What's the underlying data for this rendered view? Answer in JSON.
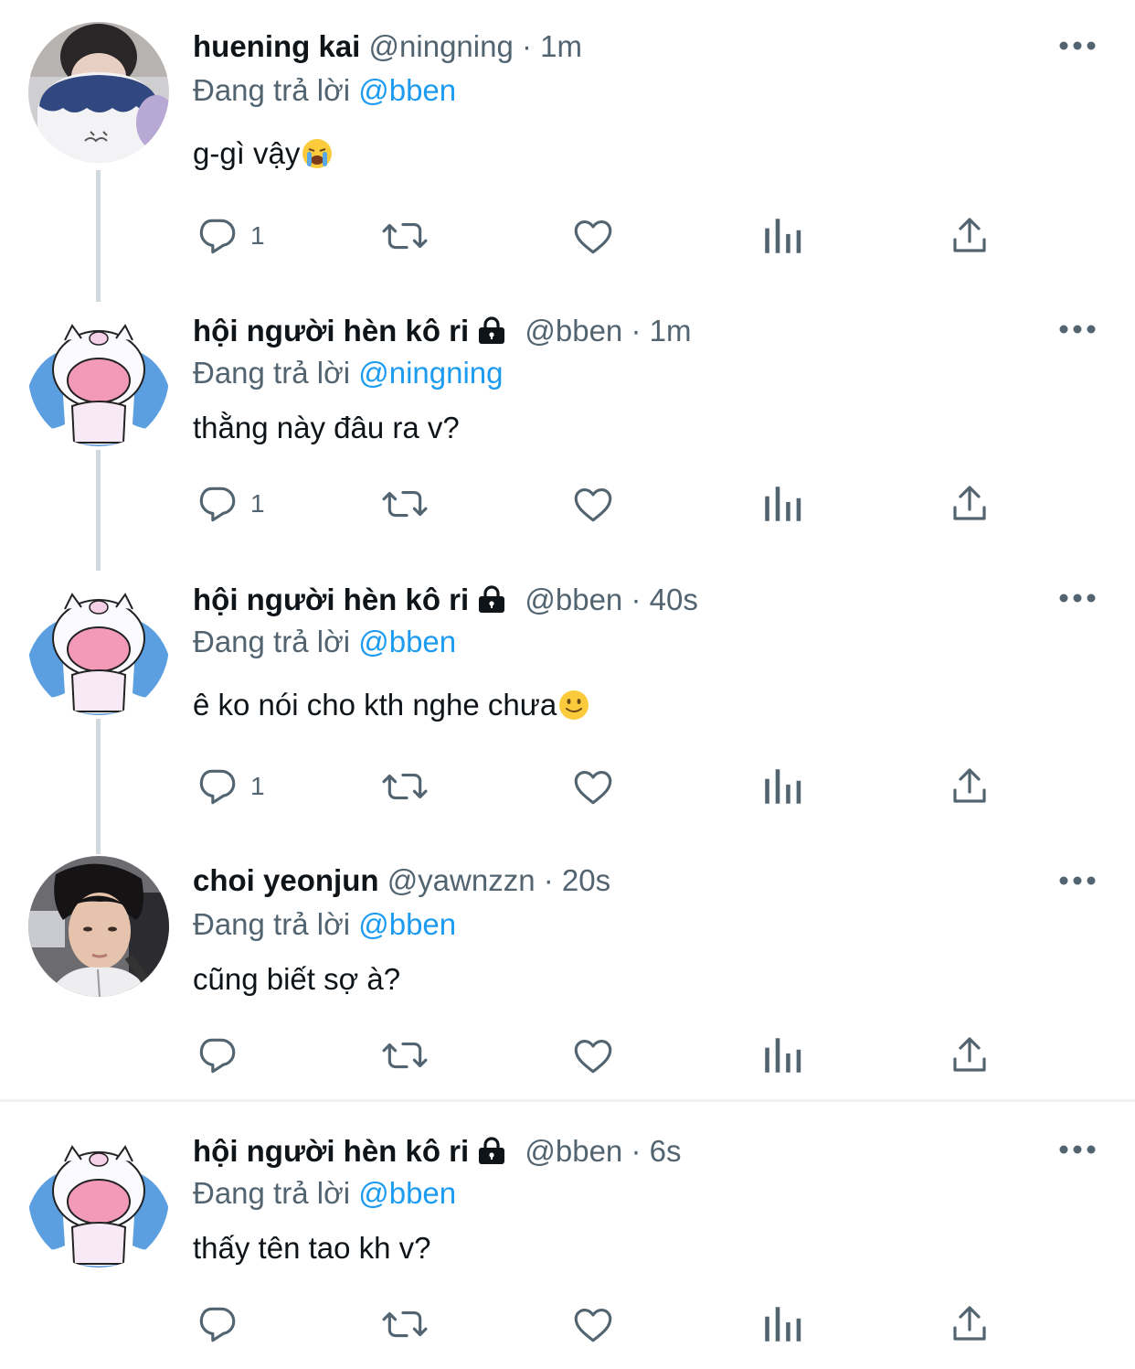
{
  "tweets": [
    {
      "name": "huening kai",
      "handle": "@ningning",
      "time": "1m",
      "reply_prefix": "Đang trả lời",
      "reply_to": "@bben",
      "text": "g-gì vậy",
      "emoji": "loudly-crying-face",
      "reply_count": "1",
      "locked": false,
      "avatar": "photo-person-with-blue-pillow"
    },
    {
      "name": "hội người hèn kô ri",
      "handle": "@bben",
      "time": "1m",
      "reply_prefix": "Đang trả lời",
      "reply_to": "@ningning",
      "text": "thằng này đâu ra v?",
      "reply_count": "1",
      "locked": true,
      "avatar": "crying-cartoon-cat"
    },
    {
      "name": "hội người hèn kô ri",
      "handle": "@bben",
      "time": "40s",
      "reply_prefix": "Đang trả lời",
      "reply_to": "@bben",
      "text": "ê ko nói cho kth nghe chưa",
      "emoji": "slightly-smiling-face",
      "reply_count": "1",
      "locked": true,
      "avatar": "crying-cartoon-cat"
    },
    {
      "name": "choi yeonjun",
      "handle": "@yawnzzn",
      "time": "20s",
      "reply_prefix": "Đang trả lời",
      "reply_to": "@bben",
      "text": "cũng biết sợ à?",
      "reply_count": "",
      "locked": false,
      "avatar": "photo-person-in-car"
    },
    {
      "name": "hội người hèn kô ri",
      "handle": "@bben",
      "time": "6s",
      "reply_prefix": "Đang trả lời",
      "reply_to": "@bben",
      "text": "thấy tên tao kh v?",
      "reply_count": "",
      "locked": true,
      "avatar": "crying-cartoon-cat"
    }
  ],
  "separator": "·",
  "icons": [
    "reply-icon",
    "retweet-icon",
    "like-icon",
    "analytics-icon",
    "share-icon",
    "more-icon",
    "lock-icon"
  ],
  "colors": {
    "text": "#0f1419",
    "secondary": "#536471",
    "accent": "#1d9bf0",
    "thread_line": "#cfd9de"
  }
}
